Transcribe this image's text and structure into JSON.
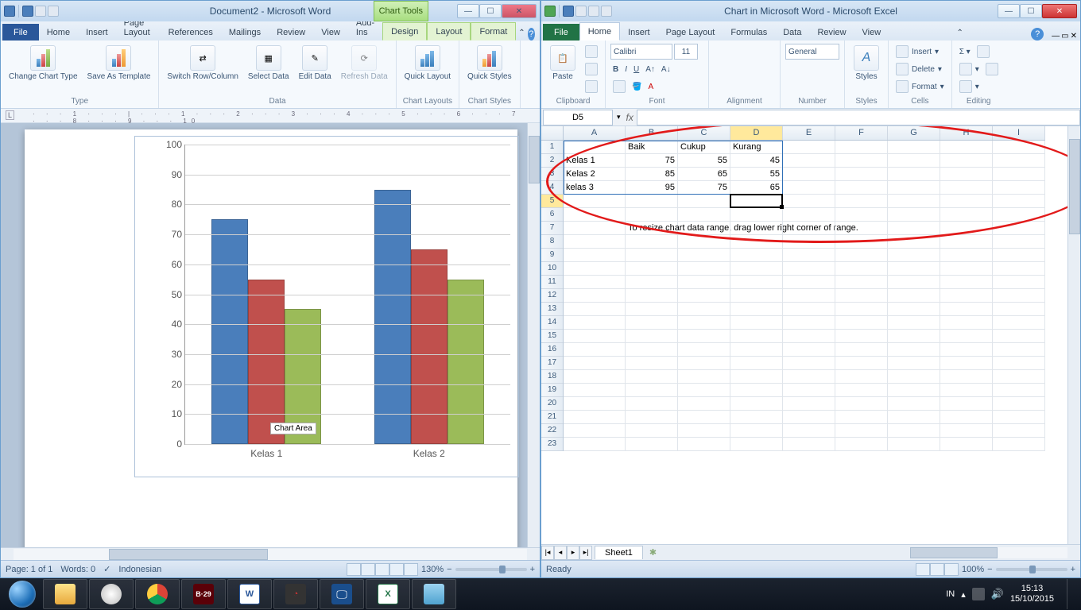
{
  "word": {
    "title": "Document2 - Microsoft Word",
    "chart_tools_label": "Chart Tools",
    "tabs": [
      "File",
      "Home",
      "Insert",
      "Page Layout",
      "References",
      "Mailings",
      "Review",
      "View",
      "Add-Ins",
      "Design",
      "Layout",
      "Format"
    ],
    "ribbon": {
      "type_group": "Type",
      "change": "Change\nChart Type",
      "save_as": "Save As\nTemplate",
      "data_group": "Data",
      "switch": "Switch\nRow/Column",
      "select": "Select\nData",
      "edit": "Edit\nData",
      "refresh": "Refresh\nData",
      "layouts_group": "Chart Layouts",
      "quick_layout": "Quick\nLayout",
      "styles_group": "Chart Styles",
      "quick_styles": "Quick\nStyles"
    },
    "chart_tooltip": "Chart Area",
    "status": {
      "page": "Page: 1 of 1",
      "words": "Words: 0",
      "lang": "Indonesian",
      "zoom": "130%"
    }
  },
  "excel": {
    "title": "Chart in Microsoft Word - Microsoft Excel",
    "tabs": [
      "File",
      "Home",
      "Insert",
      "Page Layout",
      "Formulas",
      "Data",
      "Review",
      "View"
    ],
    "ribbon": {
      "clipboard": "Clipboard",
      "paste": "Paste",
      "font_group": "Font",
      "font_name": "Calibri",
      "font_size": "11",
      "align_group": "Alignment",
      "number_group": "Number",
      "number_format": "General",
      "styles_group": "Styles",
      "styles": "Styles",
      "cells_group": "Cells",
      "insert": "Insert",
      "delete": "Delete",
      "format": "Format",
      "editing_group": "Editing"
    },
    "namebox": "D5",
    "columns": [
      "A",
      "B",
      "C",
      "D",
      "E",
      "F",
      "G",
      "H",
      "I"
    ],
    "rows": 23,
    "data": {
      "r1": {
        "B": "Baik",
        "C": "Cukup",
        "D": "Kurang"
      },
      "r2": {
        "A": "Kelas 1",
        "B": "75",
        "C": "55",
        "D": "45"
      },
      "r3": {
        "A": "Kelas 2",
        "B": "85",
        "C": "65",
        "D": "55"
      },
      "r4": {
        "A": "kelas 3",
        "B": "95",
        "C": "75",
        "D": "65"
      }
    },
    "hint": "To resize chart data range, drag lower right corner of range.",
    "sheet_tab": "Sheet1",
    "status": {
      "ready": "Ready",
      "zoom": "100%"
    }
  },
  "chart_data": {
    "type": "bar",
    "categories": [
      "Kelas 1",
      "Kelas 2"
    ],
    "series": [
      {
        "name": "Baik",
        "values": [
          75,
          85
        ],
        "color": "#4a7ebb"
      },
      {
        "name": "Cukup",
        "values": [
          55,
          65
        ],
        "color": "#c0504d"
      },
      {
        "name": "Kurang",
        "values": [
          45,
          55
        ],
        "color": "#9bbb59"
      }
    ],
    "ylim": [
      0,
      100
    ],
    "ystep": 10,
    "title": "",
    "xlabel": "",
    "ylabel": ""
  },
  "taskbar": {
    "lang": "IN",
    "time": "15:13",
    "date": "15/10/2015"
  }
}
